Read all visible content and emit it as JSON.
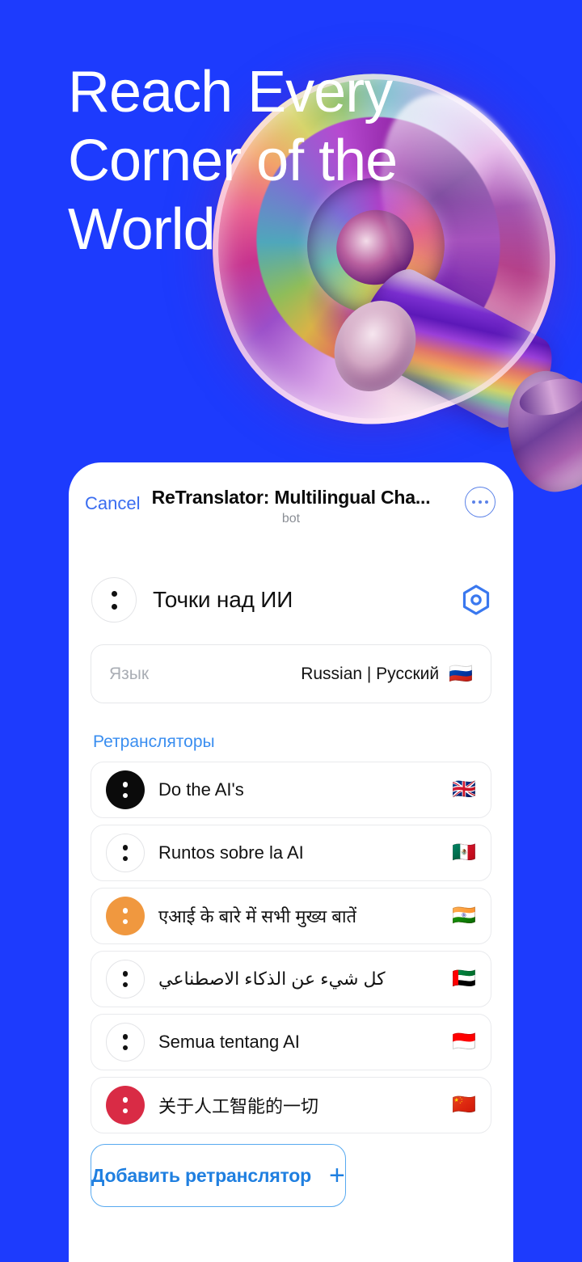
{
  "hero": {
    "headline": "Reach Every\nCorner of the\nWorld",
    "background_color": "#1d3bfd",
    "illustration": "iridescent-megaphone"
  },
  "card": {
    "header": {
      "cancel_label": "Cancel",
      "title": "ReTranslator: Multilingual Cha...",
      "subtitle": "bot",
      "more_icon": "more-dots-icon"
    },
    "chat": {
      "avatar_icon": "two-dots-avatar-icon",
      "title": "Точки над ИИ",
      "settings_icon": "hexagon-settings-icon",
      "settings_color": "#3a78ef"
    },
    "language_field": {
      "label": "Язык",
      "value": "Russian | Русский",
      "flag": "🇷🇺"
    },
    "section_title": "Ретрансляторы",
    "section_title_color": "#3a8ef0",
    "relays": [
      {
        "label": "Do the AI's",
        "flag": "🇬🇧",
        "avatar_style": "filled",
        "avatar_color": "#0b0b0b",
        "rtl": false
      },
      {
        "label": "Runtos sobre la AI",
        "flag": "🇲🇽",
        "avatar_style": "outline",
        "avatar_color": "#ffffff",
        "rtl": false
      },
      {
        "label": "एआई के बारे में सभी मुख्य बातें",
        "flag": "🇮🇳",
        "avatar_style": "filled",
        "avatar_color": "#f0983f",
        "rtl": false
      },
      {
        "label": "كل شيء عن الذكاء الاصطناعي",
        "flag": "🇦🇪",
        "avatar_style": "outline",
        "avatar_color": "#ffffff",
        "rtl": true
      },
      {
        "label": "Semua tentang AI",
        "flag": "🇮🇩",
        "avatar_style": "outline",
        "avatar_color": "#ffffff",
        "rtl": false
      },
      {
        "label": "关于人工智能的一切",
        "flag": "🇨🇳",
        "avatar_style": "filled",
        "avatar_color": "#d92b45",
        "rtl": false
      }
    ],
    "add_button": {
      "label": "Добавить ретранслятор",
      "plus": "+",
      "color": "#1f7fe0"
    }
  }
}
